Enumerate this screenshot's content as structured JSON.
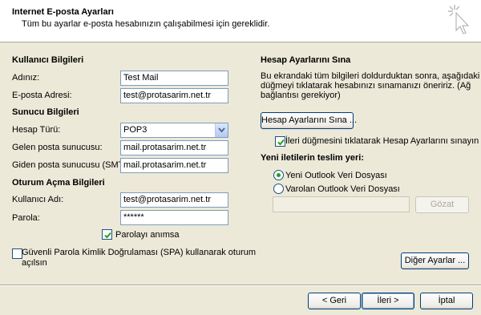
{
  "header": {
    "title": "Internet E-posta Ayarları",
    "subtitle": "Tüm bu ayarlar e-posta hesabınızın çalışabilmesi için gereklidir."
  },
  "user_info": {
    "section": "Kullanıcı Bilgileri",
    "name_label": "Adınız:",
    "name_value": "Test Mail",
    "email_label": "E-posta Adresi:",
    "email_value": "test@protasarim.net.tr"
  },
  "server_info": {
    "section": "Sunucu Bilgileri",
    "account_type_label": "Hesap Türü:",
    "account_type_value": "POP3",
    "incoming_label": "Gelen posta sunucusu:",
    "incoming_value": "mail.protasarim.net.tr",
    "outgoing_label": "Giden posta sunucusu (SMTP):",
    "outgoing_value": "mail.protasarim.net.tr"
  },
  "logon_info": {
    "section": "Oturum Açma Bilgileri",
    "username_label": "Kullanıcı Adı:",
    "username_value": "test@protasarim.net.tr",
    "password_label": "Parola:",
    "password_value": "******",
    "remember_label": "Parolayı anımsa",
    "remember_checked": true,
    "spa_label_line1": "Güvenli Parola Kimlik Doğrulaması (SPA) kullanarak oturum",
    "spa_label_line2": "açılsın",
    "spa_checked": false
  },
  "test_settings": {
    "section": "Hesap Ayarlarını Sına",
    "description_line1": "Bu ekrandaki tüm bilgileri doldurduktan sonra, aşağıdaki",
    "description_line2": "düğmeyi tıklatarak hesabınızı sınamanızı öneririz. (Ağ",
    "description_line3": "bağlantısı gerekiyor)",
    "test_button": "Hesap Ayarlarını Sına ...",
    "auto_test_label": "İleri düğmesini tıklatarak Hesap Ayarlarını sınayın",
    "auto_test_checked": true
  },
  "delivery": {
    "section": "Yeni iletilerin teslim yeri:",
    "option_new": "Yeni Outlook Veri Dosyası",
    "option_existing": "Varolan Outlook Veri Dosyası",
    "selected": "new",
    "path_value": "",
    "browse_button": "Gözat"
  },
  "buttons": {
    "more_settings": "Diğer Ayarlar ...",
    "back": "< Geri",
    "next": "İleri >",
    "cancel": "İptal"
  },
  "colors": {
    "dialog_bg": "#ece9d8",
    "header_bg": "#ffffff",
    "check_mark": "#21a121",
    "radio_dot": "#21a121"
  }
}
